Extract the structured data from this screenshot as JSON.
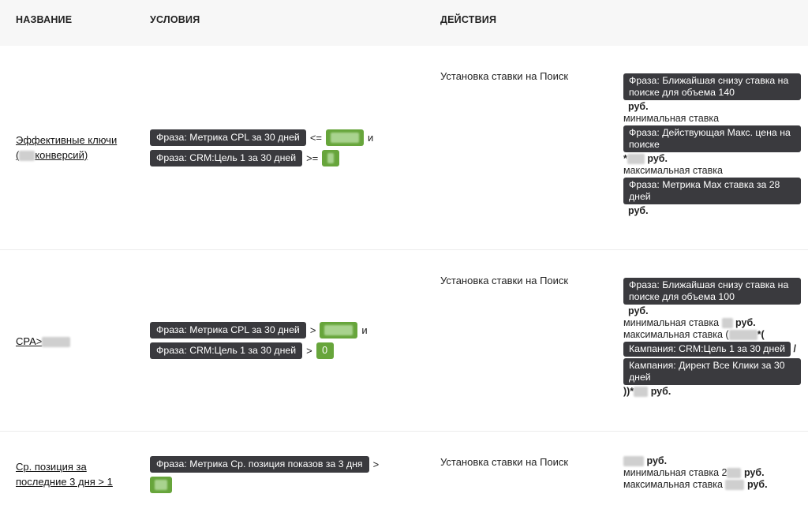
{
  "header": {
    "col_name": "НАЗВАНИЕ",
    "col_conditions": "УСЛОВИЯ",
    "col_actions": "ДЕЙСТВИЯ"
  },
  "rows": [
    {
      "name_line1": "Эффективные ключи",
      "name_line2_prefix": "(",
      "name_line2_suffix": "конверсий)",
      "cond1_chip": "Фраза: Метрика CPL за 30 дней",
      "cond1_op": "<=",
      "cond1_join": "и",
      "cond2_chip": "Фраза: CRM:Цель 1 за 30 дней",
      "cond2_op": ">=",
      "action": "Установка ставки на Поиск",
      "d_chip1": "Фраза: Ближайшая снизу ставка на поиске для объема 140",
      "d_rub1": "руб.",
      "d_min": "минимальная ставка",
      "d_chip2": "Фраза: Действующая Макс. цена на поиске",
      "d_mult": "*",
      "d_rub2": "руб.",
      "d_max": "максимальная ставка",
      "d_chip3": "Фраза: Метрика Max ставка за 28 дней",
      "d_rub3": "руб."
    },
    {
      "name_prefix": "CPA>",
      "cond1_chip": "Фраза: Метрика CPL за 30 дней",
      "cond1_op": ">",
      "cond1_join": "и",
      "cond2_chip": "Фраза: CRM:Цель 1 за 30 дней",
      "cond2_op": ">",
      "cond2_value": "0",
      "action": "Установка ставки на Поиск",
      "d_chip1": "Фраза: Ближайшая снизу ставка на поиске для объема 100",
      "d_rub1": "руб.",
      "d_min": "минимальная ставка",
      "d_min_unit": "руб.",
      "d_max": "максимальная ставка (",
      "d_max_tail": "*(",
      "d_chip2": "Кампания: CRM:Цель 1 за 30 дней",
      "d_slash": "/",
      "d_chip3": "Кампания: Директ Все Клики за 30 дней",
      "d_close": "))*",
      "d_rub3": "руб."
    },
    {
      "name_line1": "Ср. позиция за",
      "name_line2": "последние 3 дня > 1",
      "cond1_chip": "Фраза: Метрика Ср. позиция показов за 3 дня",
      "cond1_op": ">",
      "action": "Установка ставки на Поиск",
      "d_rub1": "руб.",
      "d_min": "минимальная ставка 2",
      "d_min_unit": "руб.",
      "d_max": "максимальная ставка",
      "d_max_unit": "руб."
    }
  ]
}
